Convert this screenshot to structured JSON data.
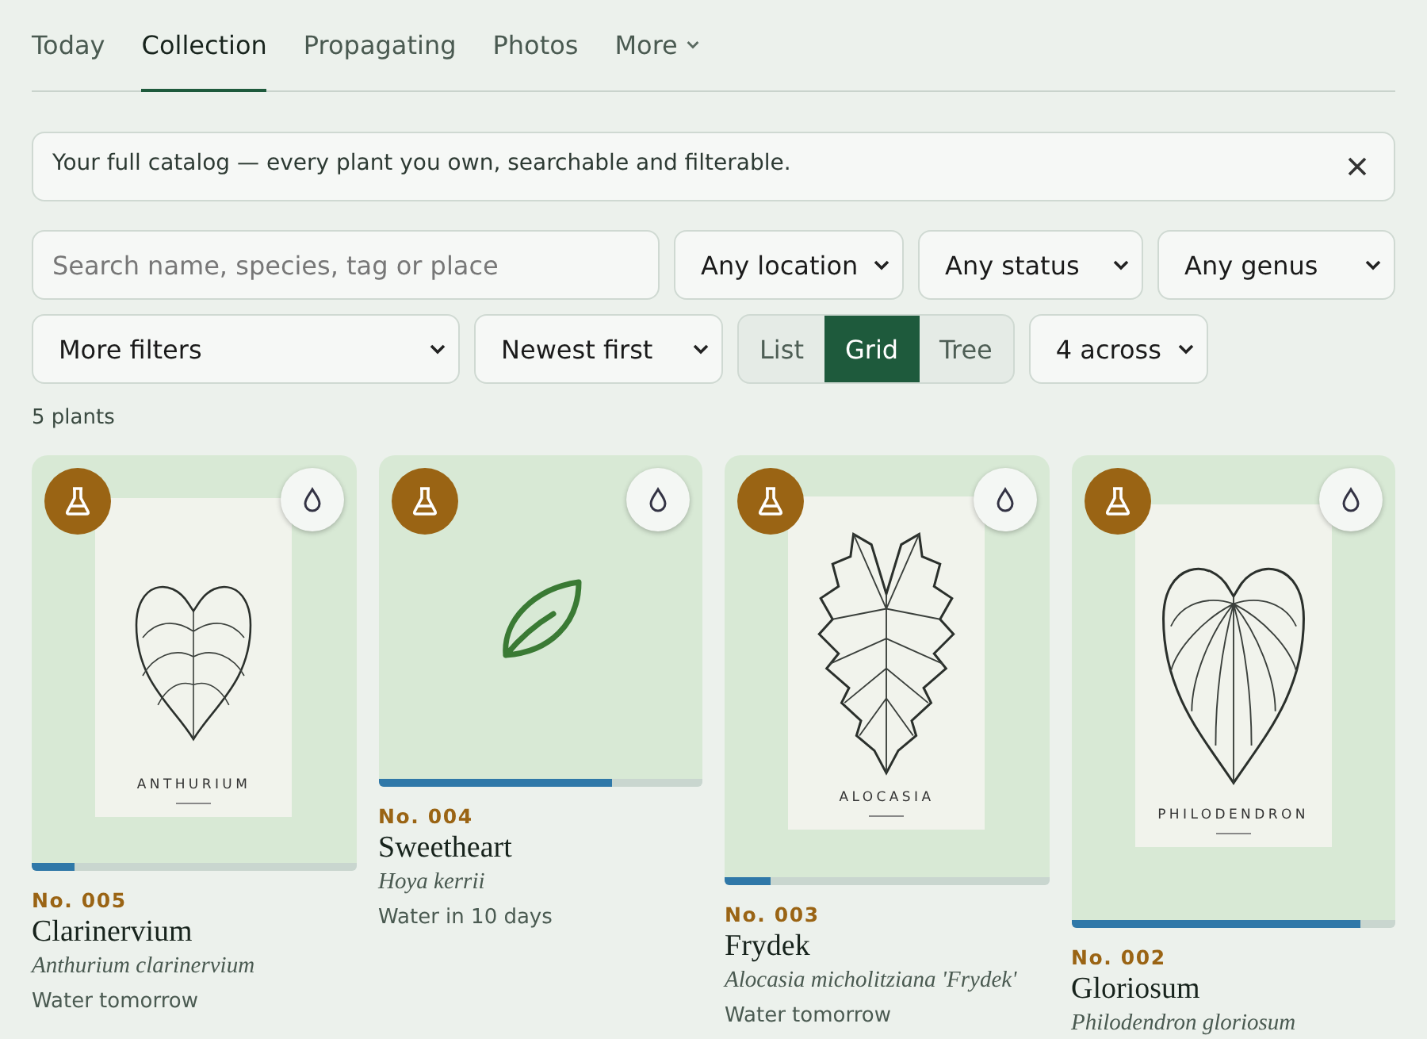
{
  "tabs": [
    {
      "label": "Today",
      "selected": false,
      "kind": "link"
    },
    {
      "label": "Collection",
      "selected": true,
      "kind": "link"
    },
    {
      "label": "Propagating",
      "selected": false,
      "kind": "link"
    },
    {
      "label": "Photos",
      "selected": false,
      "kind": "link"
    },
    {
      "label": "More",
      "selected": false,
      "kind": "menu"
    }
  ],
  "banner": {
    "text": "Your full catalog — every plant you own, searchable and filterable."
  },
  "search": {
    "placeholder": "Search name, species, tag or place"
  },
  "filters": [
    {
      "value": "Any location"
    },
    {
      "value": "Any status"
    },
    {
      "value": "Any genus"
    }
  ],
  "more_filters": {
    "value": "More filters"
  },
  "sort": {
    "value": "Newest first"
  },
  "view_modes": [
    {
      "label": "List",
      "selected": false
    },
    {
      "label": "Grid",
      "selected": true
    },
    {
      "label": "Tree",
      "selected": false
    }
  ],
  "columns": {
    "value": "4 across"
  },
  "count": "5 plants",
  "plants": [
    {
      "kind": "anthurium",
      "poster_label": "ANTHURIUM",
      "level": 0.13,
      "number": "No. 005",
      "name": "Clarinervium",
      "species": "Anthurium clarinervium",
      "water": "Water tomorrow"
    },
    {
      "kind": "placeholder",
      "level": 0.72,
      "number": "No. 004",
      "name": "Sweetheart",
      "species": "Hoya kerrii",
      "water": "Water in 10 days"
    },
    {
      "kind": "alocasia",
      "poster_label": "ALOCASIA",
      "level": 0.14,
      "number": "No. 003",
      "name": "Frydek",
      "species": "Alocasia micholitziana 'Frydek'",
      "water": "Water tomorrow"
    },
    {
      "kind": "philodendron",
      "poster_label": "PHILODENDRON",
      "level": 0.89,
      "number": "No. 002",
      "name": "Gloriosum",
      "species": "Philodendron gloriosum"
    }
  ]
}
